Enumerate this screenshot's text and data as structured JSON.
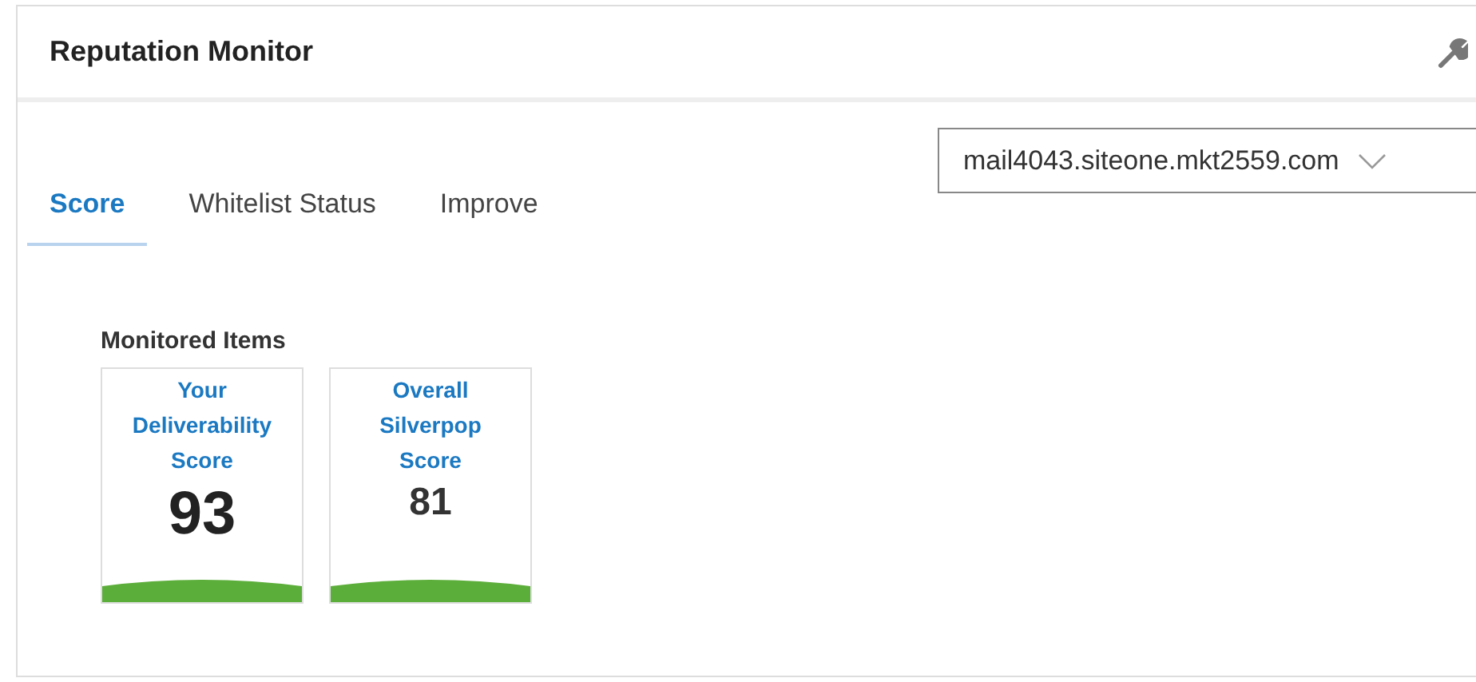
{
  "panel": {
    "title": "Reputation Monitor"
  },
  "tabs": [
    {
      "label": "Score",
      "selected": true
    },
    {
      "label": "Whitelist Status",
      "selected": false
    },
    {
      "label": "Improve",
      "selected": false
    }
  ],
  "domain_select": {
    "value": "mail4043.siteone.mkt2559.com"
  },
  "monitored_items": {
    "heading": "Monitored Items",
    "cards": [
      {
        "title_lines": [
          "Your",
          "Deliverability",
          "Score"
        ],
        "score": "93",
        "emphasized": true
      },
      {
        "title_lines": [
          "Overall",
          "Silverpop",
          "Score"
        ],
        "score": "81",
        "emphasized": false
      }
    ]
  }
}
